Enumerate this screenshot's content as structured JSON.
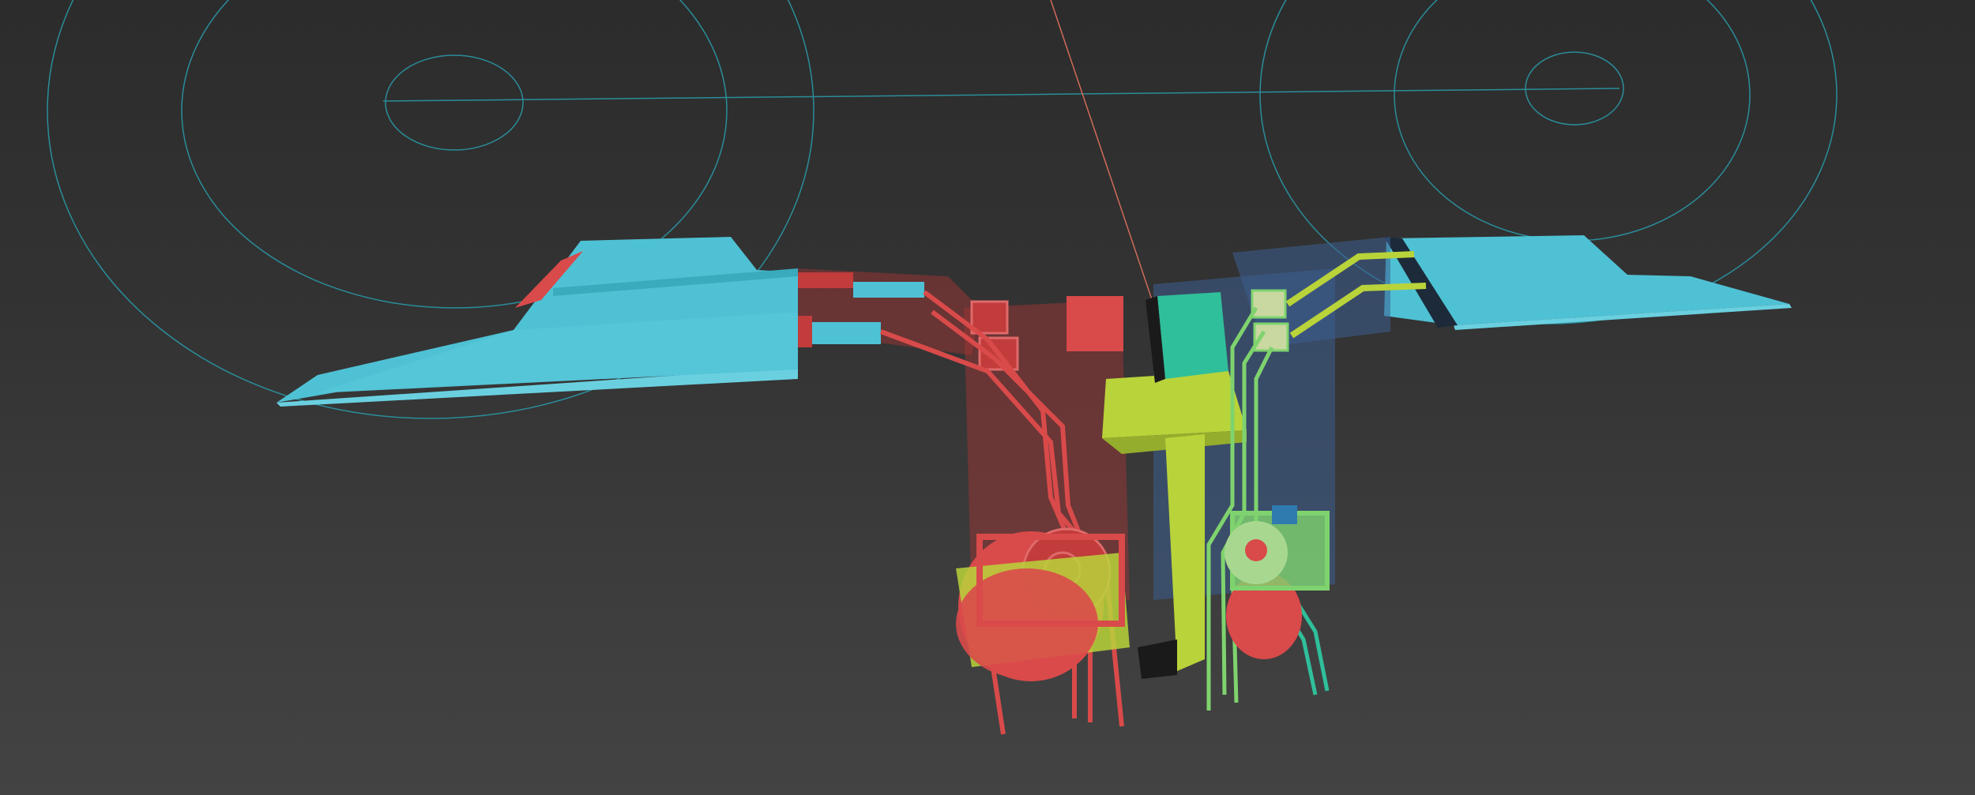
{
  "viewport": {
    "background_top": "#2c2c2c",
    "background_bottom": "#434343"
  },
  "colors": {
    "left_wing": "#4fc1d4",
    "left_wing_shade": "#2f9fb3",
    "right_wing": "#52c3d6",
    "red_assembly": "#d94a4a",
    "red_assembly_dark": "#a83535",
    "lime_bracket": "#b9d33a",
    "lime_bracket_dark": "#7f9422",
    "green_assembly": "#7fd36e",
    "blue_housing": "#3d5f8f",
    "teal_part": "#2fbf9a",
    "guide_circles": "#2a8d9a",
    "axis_line": "#d06a5a"
  }
}
